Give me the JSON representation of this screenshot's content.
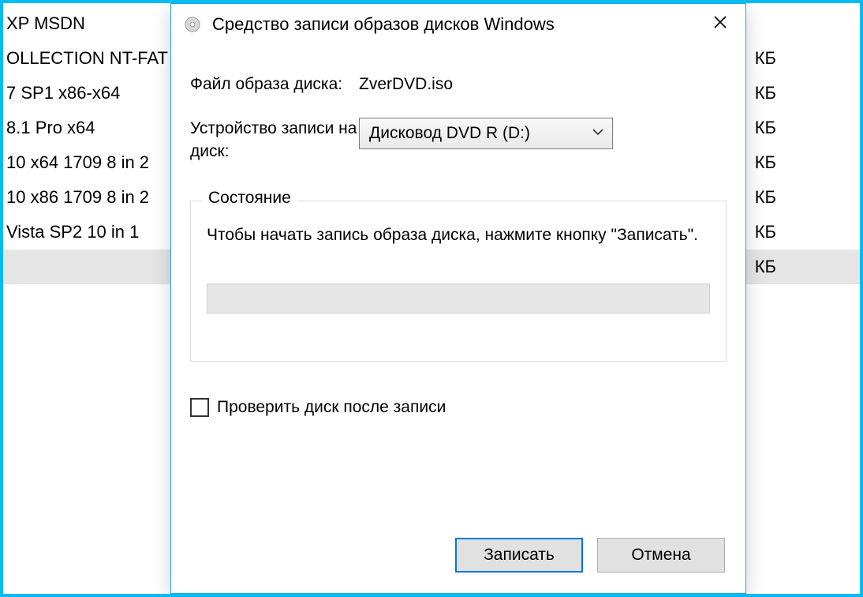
{
  "background": {
    "files": [
      {
        "name": "XP MSDN",
        "size": ""
      },
      {
        "name": "OLLECTION NT-FAT",
        "size": "КБ"
      },
      {
        "name": "7 SP1 x86-x64",
        "size": "КБ"
      },
      {
        "name": "8.1 Pro x64",
        "size": "КБ"
      },
      {
        "name": "10 x64 1709 8 in 2",
        "size": "КБ"
      },
      {
        "name": "10 x86 1709 8 in 2",
        "size": "КБ"
      },
      {
        "name": "Vista SP2 10 in 1",
        "size": "КБ"
      },
      {
        "name": "",
        "size": "КБ",
        "selected": true
      }
    ]
  },
  "dialog": {
    "title": "Средство записи образов дисков Windows",
    "image_file_label": "Файл образа диска:",
    "image_file_value": "ZverDVD.iso",
    "burner_label": "Устройство записи на диск:",
    "burner_value": "Дисковод DVD R (D:)",
    "status_legend": "Состояние",
    "status_text": "Чтобы начать запись образа диска, нажмите кнопку \"Записать\".",
    "verify_label": "Проверить диск после записи",
    "burn_button": "Записать",
    "cancel_button": "Отмена"
  }
}
